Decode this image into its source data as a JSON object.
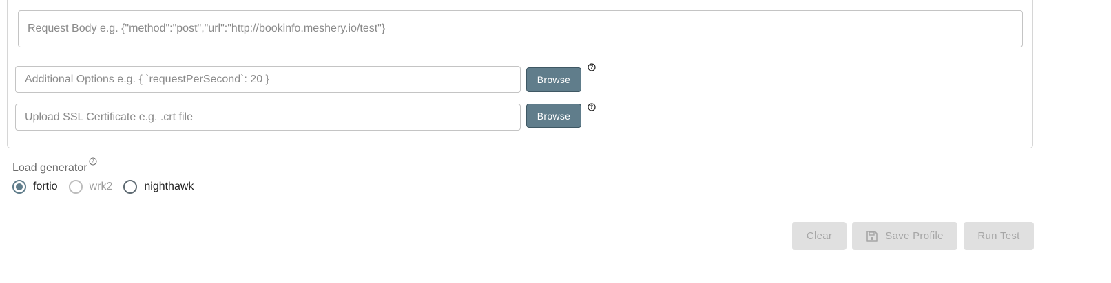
{
  "request_body": {
    "placeholder": "Request Body e.g. {\"method\":\"post\",\"url\":\"http://bookinfo.meshery.io/test\"}"
  },
  "additional_options": {
    "placeholder": "Additional Options e.g. { `requestPerSecond`: 20 }",
    "browse_label": "Browse"
  },
  "ssl_certificate": {
    "placeholder": "Upload SSL Certificate e.g. .crt file",
    "browse_label": "Browse"
  },
  "load_generator": {
    "label": "Load generator",
    "options": [
      {
        "label": "fortio",
        "checked": true,
        "disabled": false
      },
      {
        "label": "wrk2",
        "checked": false,
        "disabled": true
      },
      {
        "label": "nighthawk",
        "checked": false,
        "disabled": false
      }
    ]
  },
  "actions": {
    "clear_label": "Clear",
    "save_profile_label": "Save Profile",
    "run_test_label": "Run Test"
  },
  "colors": {
    "accent": "#607d8b",
    "disabled_button_bg": "#e0e0e0",
    "disabled_button_text": "#a6a6a6"
  },
  "icons": {
    "help": "help-circle-icon",
    "save": "floppy-disk-icon"
  }
}
